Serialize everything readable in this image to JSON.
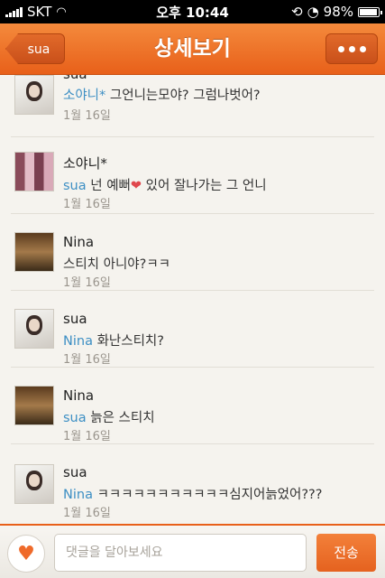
{
  "status_bar": {
    "carrier": "SKT",
    "time": "오후 10:44",
    "battery": "98%"
  },
  "nav": {
    "back_label": "sua",
    "title": "상세보기"
  },
  "comments": [
    {
      "name": "sua",
      "mention": "소야니*",
      "text": "그언니는모야? 그럼나벗어?",
      "date": "1월 16일",
      "avatar": "sua"
    },
    {
      "name": "소야니*",
      "mention": "sua",
      "text": "넌 예뻐",
      "text_after": " 있어 잘나가는 그 언니",
      "date": "1월 16일",
      "avatar": "soyani",
      "heart": "❤"
    },
    {
      "name": "Nina",
      "mention": "",
      "text": "스티치 아니야?ㅋㅋ",
      "date": "1월 16일",
      "avatar": "nina"
    },
    {
      "name": "sua",
      "mention": "Nina",
      "text": "화난스티치?",
      "date": "1월 16일",
      "avatar": "sua"
    },
    {
      "name": "Nina",
      "mention": "sua",
      "text": "늙은 스티치",
      "date": "1월 16일",
      "avatar": "nina"
    },
    {
      "name": "sua",
      "mention": "Nina",
      "text": "ㅋㅋㅋㅋㅋㅋㅋㅋㅋㅋㅋ심지어늙었어???",
      "date": "1월 16일",
      "avatar": "sua"
    }
  ],
  "bottom": {
    "like_icon": "heart-icon",
    "input_placeholder": "댓글을 달아보세요",
    "send_label": "전송"
  },
  "colors": {
    "accent": "#e8601a",
    "mention": "#3d8fc4"
  }
}
